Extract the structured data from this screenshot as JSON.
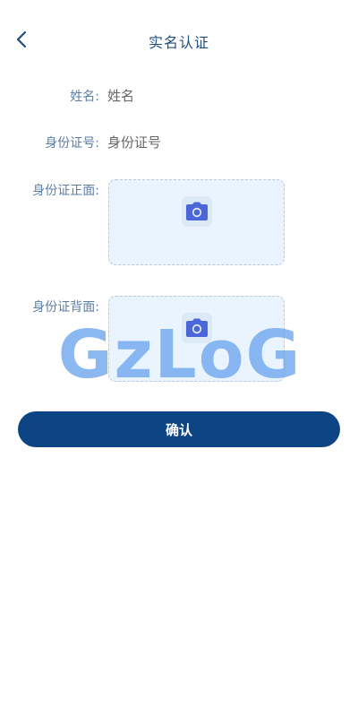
{
  "header": {
    "title": "实名认证",
    "back_icon": "chevron-left-icon"
  },
  "form": {
    "name": {
      "label": "姓名:",
      "placeholder": "姓名"
    },
    "id_number": {
      "label": "身份证号:",
      "placeholder": "身份证号"
    },
    "id_front": {
      "label": "身份证正面:",
      "icon": "camera-icon"
    },
    "id_back": {
      "label": "身份证背面:",
      "icon": "camera-icon"
    }
  },
  "watermark": {
    "text": "GzLoG"
  },
  "actions": {
    "confirm_label": "确认"
  },
  "colors": {
    "title": "#1f4f7f",
    "label": "#5b7fa6",
    "upload_bg": "#e9f4fe",
    "upload_border": "#b9c9dc",
    "camera": "#4a66d8",
    "button": "#0d4584",
    "watermark": "#6ca4ee"
  }
}
